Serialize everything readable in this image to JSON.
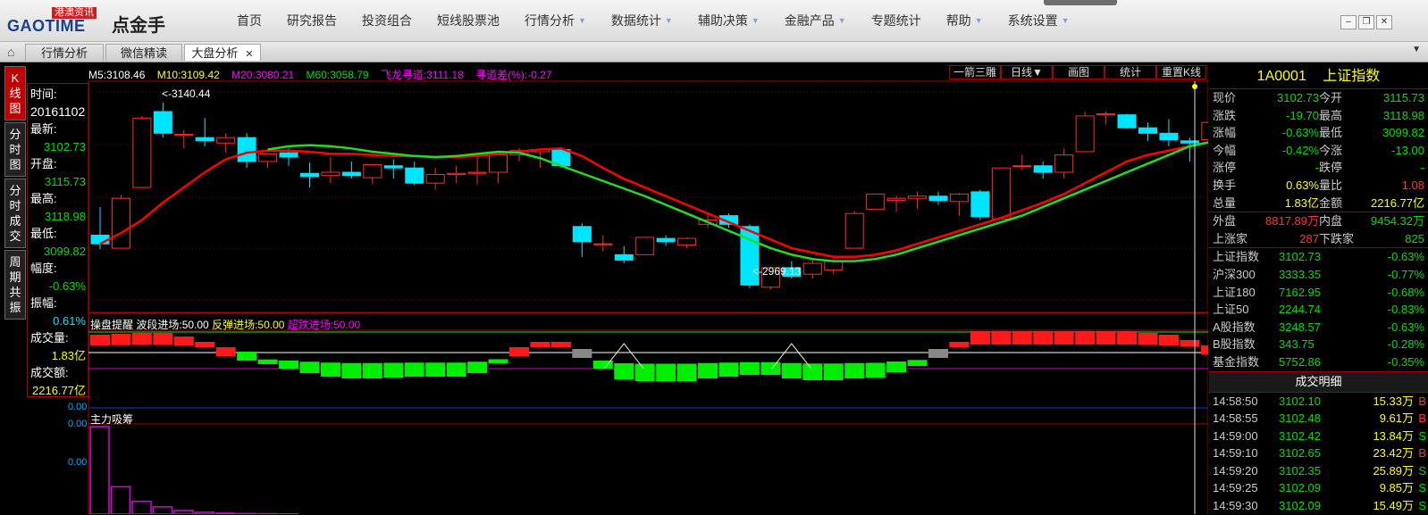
{
  "app": {
    "logo_en": "GAOTIME",
    "logo_badge": "港澳资讯",
    "logo_cn": "点金手"
  },
  "menu": [
    {
      "label": "首页",
      "arrow": false
    },
    {
      "label": "研究报告",
      "arrow": false
    },
    {
      "label": "投资组合",
      "arrow": false
    },
    {
      "label": "短线股票池",
      "arrow": false
    },
    {
      "label": "行情分析",
      "arrow": true
    },
    {
      "label": "数据统计",
      "arrow": true
    },
    {
      "label": "辅助决策",
      "arrow": true
    },
    {
      "label": "金融产品",
      "arrow": true
    },
    {
      "label": "专题统计",
      "arrow": false
    },
    {
      "label": "帮助",
      "arrow": true
    },
    {
      "label": "系统设置",
      "arrow": true
    }
  ],
  "tabs": [
    {
      "label": "行情分析",
      "active": false
    },
    {
      "label": "微信精读",
      "active": false
    },
    {
      "label": "大盘分析",
      "active": true
    }
  ],
  "sidebar": [
    "K线图",
    "分时图",
    "分时成交",
    "周期共振"
  ],
  "info": {
    "time_label": "时间:",
    "time_value": "20161102",
    "latest_label": "最新:",
    "latest_value": "3102.73",
    "open_label": "开盘:",
    "open_value": "3115.73",
    "high_label": "最高:",
    "high_value": "3118.98",
    "low_label": "最低:",
    "low_value": "3099.82",
    "range_label": "幅度:",
    "range_value": "-0.63%",
    "amp_label": "振幅:",
    "amp_value": "0.61%",
    "vol_label": "成交量:",
    "vol_value": "1.83亿",
    "amt_label": "成交额:",
    "amt_value": "2216.77亿"
  },
  "ma_bar": {
    "m5": "M5:3108.46",
    "m10": "M10:3109.42",
    "m20": "M20:3080.21",
    "m60": "M60:3058.79",
    "flydragon": "飞龙寻道:3111.18",
    "devi": "寻道差(%):-0.27"
  },
  "k_buttons": [
    "一箭三雕",
    "日线▼",
    "画图",
    "统计",
    "重置K线"
  ],
  "annotations": {
    "high": "<-3140.44",
    "low": "<-2969.13"
  },
  "panel2": {
    "title": "操盘提醒",
    "wave": "波段进场:50.00",
    "rebound": "反弹进场:50.00",
    "overfall": "超跌进场:50.00",
    "axis": "0.00"
  },
  "panel3": {
    "title": "主力吸筹",
    "axis_top": "0.00",
    "axis_mid": "0.00"
  },
  "colors": {
    "up": "#ff2a2a",
    "down": "#00e5ff",
    "ma_red": "#ff0000",
    "ma_green": "#22dd22"
  },
  "chart_data": {
    "type": "candlestick",
    "title": "",
    "ylim": [
      2955,
      3160
    ],
    "candles": [
      {
        "o": 3018,
        "h": 3044,
        "l": 3005,
        "c": 3010
      },
      {
        "o": 3006,
        "h": 3055,
        "l": 3006,
        "c": 3052
      },
      {
        "o": 3062,
        "h": 3128,
        "l": 3062,
        "c": 3126
      },
      {
        "o": 3132,
        "h": 3140.44,
        "l": 3108,
        "c": 3112
      },
      {
        "o": 3110,
        "h": 3115,
        "l": 3098,
        "c": 3111
      },
      {
        "o": 3108,
        "h": 3126,
        "l": 3100,
        "c": 3105
      },
      {
        "o": 3103,
        "h": 3112,
        "l": 3094,
        "c": 3108
      },
      {
        "o": 3108,
        "h": 3112,
        "l": 3080,
        "c": 3086
      },
      {
        "o": 3086,
        "h": 3094,
        "l": 3080,
        "c": 3093
      },
      {
        "o": 3094,
        "h": 3098,
        "l": 3082,
        "c": 3090
      },
      {
        "o": 3075,
        "h": 3085,
        "l": 3062,
        "c": 3072
      },
      {
        "o": 3073,
        "h": 3090,
        "l": 3066,
        "c": 3076
      },
      {
        "o": 3076,
        "h": 3086,
        "l": 3070,
        "c": 3073
      },
      {
        "o": 3071,
        "h": 3082,
        "l": 3065,
        "c": 3083
      },
      {
        "o": 3082,
        "h": 3088,
        "l": 3070,
        "c": 3080
      },
      {
        "o": 3080,
        "h": 3086,
        "l": 3064,
        "c": 3066
      },
      {
        "o": 3066,
        "h": 3080,
        "l": 3060,
        "c": 3074
      },
      {
        "o": 3074,
        "h": 3082,
        "l": 3066,
        "c": 3075
      },
      {
        "o": 3075,
        "h": 3090,
        "l": 3065,
        "c": 3076
      },
      {
        "o": 3076,
        "h": 3094,
        "l": 3066,
        "c": 3092
      },
      {
        "o": 3092,
        "h": 3098,
        "l": 3086,
        "c": 3096
      },
      {
        "o": 3095,
        "h": 3098,
        "l": 3080,
        "c": 3097
      },
      {
        "o": 3097,
        "h": 3098,
        "l": 3080,
        "c": 3082
      },
      {
        "o": 3026,
        "h": 3029,
        "l": 2998,
        "c": 3012
      },
      {
        "o": 3010,
        "h": 3018,
        "l": 3003,
        "c": 3010
      },
      {
        "o": 3000,
        "h": 3008,
        "l": 2992,
        "c": 2995
      },
      {
        "o": 3000,
        "h": 3016,
        "l": 3000,
        "c": 3016
      },
      {
        "o": 3015,
        "h": 3018,
        "l": 3008,
        "c": 3012
      },
      {
        "o": 3009,
        "h": 3016,
        "l": 3006,
        "c": 3015
      },
      {
        "o": 3028,
        "h": 3038,
        "l": 3025,
        "c": 3032
      },
      {
        "o": 3036,
        "h": 3038,
        "l": 3025,
        "c": 3028
      },
      {
        "o": 3026,
        "h": 3028,
        "l": 2969.13,
        "c": 2972
      },
      {
        "o": 2970,
        "h": 2989,
        "l": 2968,
        "c": 2988
      },
      {
        "o": 2988,
        "h": 2994,
        "l": 2978,
        "c": 2980
      },
      {
        "o": 2982,
        "h": 2996,
        "l": 2978,
        "c": 2992
      },
      {
        "o": 2986,
        "h": 2996,
        "l": 2982,
        "c": 2994
      },
      {
        "o": 3006,
        "h": 3040,
        "l": 3006,
        "c": 3038
      },
      {
        "o": 3042,
        "h": 3056,
        "l": 3042,
        "c": 3056
      },
      {
        "o": 3050,
        "h": 3054,
        "l": 3040,
        "c": 3052
      },
      {
        "o": 3052,
        "h": 3058,
        "l": 3042,
        "c": 3054
      },
      {
        "o": 3054,
        "h": 3058,
        "l": 3046,
        "c": 3050
      },
      {
        "o": 3049,
        "h": 3057,
        "l": 3036,
        "c": 3056
      },
      {
        "o": 3058,
        "h": 3060,
        "l": 3032,
        "c": 3035
      },
      {
        "o": 3033,
        "h": 3080,
        "l": 3033,
        "c": 3080
      },
      {
        "o": 3082,
        "h": 3092,
        "l": 3078,
        "c": 3082
      },
      {
        "o": 3082,
        "h": 3086,
        "l": 3070,
        "c": 3076
      },
      {
        "o": 3076,
        "h": 3098,
        "l": 3070,
        "c": 3092
      },
      {
        "o": 3095,
        "h": 3132,
        "l": 3095,
        "c": 3128
      },
      {
        "o": 3129,
        "h": 3132,
        "l": 3120,
        "c": 3130
      },
      {
        "o": 3129,
        "h": 3130,
        "l": 3116,
        "c": 3117
      },
      {
        "o": 3117,
        "h": 3122,
        "l": 3105,
        "c": 3112
      },
      {
        "o": 3112,
        "h": 3125,
        "l": 3100,
        "c": 3106
      },
      {
        "o": 3105,
        "h": 3108,
        "l": 3086,
        "c": 3103
      },
      {
        "o": 3106,
        "h": 3124,
        "l": 3101,
        "c": 3122
      },
      {
        "o": 3115.73,
        "h": 3118.98,
        "l": 3099.82,
        "c": 3102.73
      }
    ],
    "ma_red": [
      3010,
      3020,
      3032,
      3048,
      3062,
      3076,
      3088,
      3094,
      3096,
      3096,
      3095,
      3093,
      3093,
      3092,
      3091,
      3091,
      3090,
      3090,
      3091,
      3093,
      3095,
      3097,
      3098,
      3091,
      3080,
      3070,
      3062,
      3054,
      3046,
      3038,
      3030,
      3022,
      3014,
      3006,
      3002,
      2998,
      2998,
      3000,
      3004,
      3010,
      3016,
      3022,
      3028,
      3034,
      3041,
      3048,
      3056,
      3066,
      3076,
      3086,
      3092,
      3096,
      3100,
      3104,
      3110
    ],
    "ma_green": {
      "start_index": 8,
      "values": [
        3097,
        3100,
        3101,
        3100,
        3098,
        3095,
        3093,
        3091,
        3090,
        3091,
        3093,
        3095,
        3094,
        3089,
        3082,
        3075,
        3068,
        3061,
        3054,
        3046,
        3038,
        3030,
        3022,
        3014,
        3006,
        3000,
        2996,
        2994,
        2994,
        2996,
        3000,
        3006,
        3012,
        3018,
        3024,
        3030,
        3036,
        3044,
        3052,
        3060,
        3068,
        3076,
        3084,
        3092,
        3100,
        3104,
        3108,
        3112
      ]
    },
    "signal_blocks": [
      80,
      85,
      90,
      90,
      70,
      40,
      10,
      -15,
      -35,
      -60,
      -85,
      -105,
      -115,
      -115,
      -110,
      -105,
      -105,
      -105,
      -85,
      -30,
      10,
      40,
      40,
      0,
      -60,
      -120,
      -130,
      -130,
      -130,
      -115,
      -105,
      -95,
      -95,
      -115,
      -125,
      -125,
      -115,
      -110,
      -80,
      -45,
      0,
      40,
      100,
      100,
      100,
      100,
      100,
      100,
      100,
      100,
      90,
      80,
      50,
      20,
      -15
    ],
    "triangles": [
      25,
      33
    ],
    "accumulation": [
      48,
      15,
      7,
      4,
      2,
      1,
      0.5,
      0.3,
      0.2,
      0.1
    ]
  },
  "quote": {
    "code": "1A0001",
    "name": "上证指数",
    "rows": [
      {
        "l1": "现价",
        "v1": "3102.73",
        "c1": "g",
        "l2": "今开",
        "v2": "3115.73",
        "c2": "g"
      },
      {
        "l1": "涨跌",
        "v1": "-19.70",
        "c1": "g",
        "l2": "最高",
        "v2": "3118.98",
        "c2": "g"
      },
      {
        "l1": "涨幅",
        "v1": "-0.63%",
        "c1": "g",
        "l2": "最低",
        "v2": "3099.82",
        "c2": "g"
      },
      {
        "l1": "今幅",
        "v1": "-0.42%",
        "c1": "g",
        "l2": "今涨",
        "v2": "-13.00",
        "c2": "g"
      },
      {
        "l1": "涨停",
        "v1": "-",
        "c1": "g",
        "l2": "跌停",
        "v2": "-",
        "c2": "g"
      },
      {
        "l1": "换手",
        "v1": "0.63%",
        "c1": "y",
        "l2": "量比",
        "v2": "1.08",
        "c2": "r"
      },
      {
        "l1": "总量",
        "v1": "1.83亿",
        "c1": "y",
        "l2": "金额",
        "v2": "2216.77亿",
        "c2": "y"
      },
      {
        "l1": "外盘",
        "v1": "8817.89万",
        "c1": "r",
        "l2": "内盘",
        "v2": "9454.32万",
        "c2": "g"
      },
      {
        "l1": "上涨家",
        "v1": "287",
        "c1": "r",
        "l2": "下跌家",
        "v2": "825",
        "c2": "g"
      }
    ],
    "indices": [
      {
        "name": "上证指数",
        "val": "3102.73",
        "pct": "-0.63%"
      },
      {
        "name": "沪深300",
        "val": "3333.35",
        "pct": "-0.77%"
      },
      {
        "name": "上证180",
        "val": "7162.95",
        "pct": "-0.68%"
      },
      {
        "name": "上证50",
        "val": "2244.74",
        "pct": "-0.83%"
      },
      {
        "name": "A股指数",
        "val": "3248.57",
        "pct": "-0.63%"
      },
      {
        "name": "B股指数",
        "val": "343.75",
        "pct": "-0.28%"
      },
      {
        "name": "基金指数",
        "val": "5752.86",
        "pct": "-0.35%"
      }
    ],
    "detail_title": "成交明细",
    "trades": [
      {
        "time": "14:58:50",
        "price": "3102.10",
        "vol": "15.33万",
        "side": "B"
      },
      {
        "time": "14:58:55",
        "price": "3102.48",
        "vol": "9.61万",
        "side": "B"
      },
      {
        "time": "14:59:00",
        "price": "3102.42",
        "vol": "13.84万",
        "side": "S"
      },
      {
        "time": "14:59:10",
        "price": "3102.65",
        "vol": "23.42万",
        "side": "B"
      },
      {
        "time": "14:59:20",
        "price": "3102.35",
        "vol": "25.89万",
        "side": "S"
      },
      {
        "time": "14:59:25",
        "price": "3102.09",
        "vol": "9.85万",
        "side": "S"
      },
      {
        "time": "14:59:30",
        "price": "3102.09",
        "vol": "15.49万",
        "side": "S"
      }
    ]
  }
}
